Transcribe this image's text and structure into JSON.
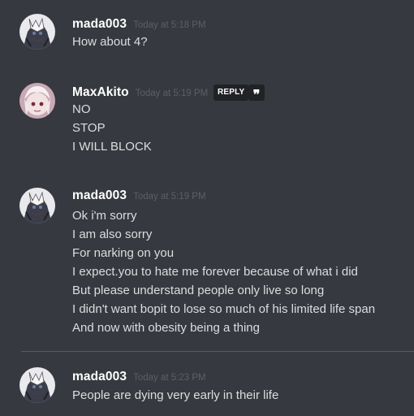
{
  "colors": {
    "background": "#36393f",
    "username": "#ffffff",
    "timestamp": "#5c5f66",
    "message_text": "#dcddde",
    "button_bg": "#202225",
    "new_messages_divider": "#7a4a4e"
  },
  "messages": [
    {
      "username": "mada003",
      "timestamp": "Today at 5:18 PM",
      "avatar": "anime-character-avatar",
      "lines": [
        "How about 4?"
      ]
    },
    {
      "username": "MaxAkito",
      "timestamp": "Today at 5:19 PM",
      "avatar": "anime-character-avatar",
      "reply_label": "REPLY",
      "quote_icon": "quote-icon",
      "quote_glyph": "❞",
      "lines": [
        "NO",
        "STOP",
        "I WILL BLOCK"
      ]
    },
    {
      "username": "mada003",
      "timestamp": "Today at 5:19 PM",
      "avatar": "anime-character-avatar",
      "lines": [
        "Ok i'm sorry",
        "I am also sorry",
        "For narking on you",
        "I expect.you to hate me forever because of what i did",
        "But please understand people only live so long",
        "I didn't want bopit to lose so much of his limited life span",
        "And now with obesity being a thing"
      ]
    },
    {
      "username": "mada003",
      "timestamp": "Today at 5:23 PM",
      "avatar": "anime-character-avatar",
      "lines": [
        "People are dying very early in their life"
      ]
    }
  ]
}
